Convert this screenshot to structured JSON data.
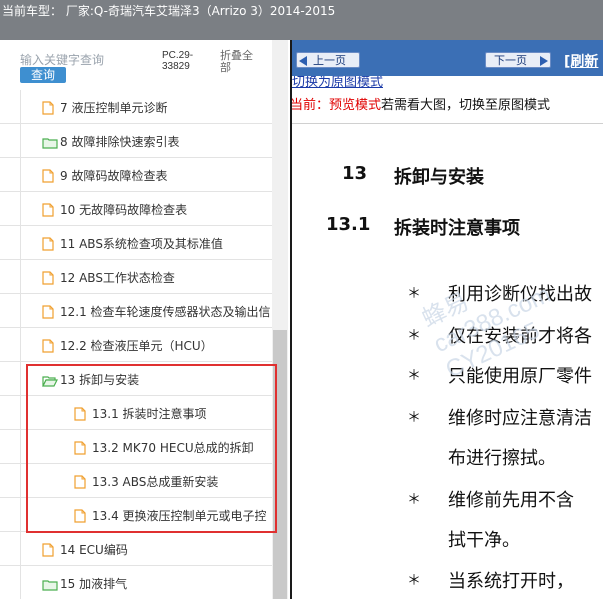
{
  "title_bar": {
    "text": "当前车型：  厂家:Q-奇瑞汽车艾瑞泽3（Arrizo 3）2014-2015"
  },
  "search": {
    "placeholder": "输入关键字查询",
    "button_label": "查询"
  },
  "pc_info": "PC.29-33829",
  "collapse_label": "折叠全部",
  "tree": [
    {
      "label": "7 液压控制单元诊断",
      "level": 1,
      "icon": "file-icon"
    },
    {
      "label": "8 故障排除快速索引表",
      "level": 1,
      "icon": "folder-icon"
    },
    {
      "label": "9 故障码故障检查表",
      "level": 1,
      "icon": "file-icon"
    },
    {
      "label": "10 无故障码故障检查表",
      "level": 1,
      "icon": "file-icon"
    },
    {
      "label": "11 ABS系统检查项及其标准值",
      "level": 1,
      "icon": "file-icon"
    },
    {
      "label": "12 ABS工作状态检查",
      "level": 1,
      "icon": "file-icon"
    },
    {
      "label": "12.1 检查车轮速度传感器状态及输出信",
      "level": 1,
      "icon": "file-icon"
    },
    {
      "label": "12.2 检查液压单元（HCU）",
      "level": 1,
      "icon": "file-icon"
    },
    {
      "label": "13 拆卸与安装",
      "level": 1,
      "icon": "folder-open-icon"
    },
    {
      "label": "13.1 拆装时注意事项",
      "level": 2,
      "icon": "file-icon"
    },
    {
      "label": "13.2 MK70 HECU总成的拆卸",
      "level": 2,
      "icon": "file-icon"
    },
    {
      "label": "13.3 ABS总成重新安装",
      "level": 2,
      "icon": "file-icon"
    },
    {
      "label": "13.4 更换液压控制单元或电子控",
      "level": 2,
      "icon": "file-icon"
    },
    {
      "label": "14 ECU编码",
      "level": 1,
      "icon": "file-icon"
    },
    {
      "label": "15 加液排气",
      "level": 1,
      "icon": "folder-icon"
    }
  ],
  "nav": {
    "prev_label": "上一页",
    "next_label": "下一页",
    "refresh_label": "[刷新"
  },
  "doc_header": {
    "switch_link": "切换为原图模式",
    "mode_label": "当前：预览模式",
    "mode_rest": "若需看大图，切换至原图模式"
  },
  "document": {
    "section_num": "13",
    "section_title": "拆卸与安装",
    "subsection_num": "13.1",
    "subsection_title": "拆装时注意事项",
    "bullet_char": "＊",
    "lines": [
      {
        "text": "利用诊断仪找出故",
        "bullet": true
      },
      {
        "text": "仅在安装前才将各",
        "bullet": true
      },
      {
        "text": "只能使用原厂零件",
        "bullet": true
      },
      {
        "text": "维修时应注意清洁",
        "bullet": true
      },
      {
        "text": "布进行擦拭。",
        "bullet": false
      },
      {
        "text": "维修前先用不含",
        "bullet": true
      },
      {
        "text": "拭干净。",
        "bullet": false
      },
      {
        "text": "当系统打开时，",
        "bullet": true
      }
    ]
  },
  "watermark": {
    "line1": "蜂易",
    "line2": "car388.com",
    "line3": "CY20165"
  },
  "colors": {
    "title_bar": "#7b7f84",
    "nav_bar": "#3b6fb5",
    "highlight": "#e03030",
    "folder": "#4caf50",
    "file": "#f0a030",
    "mode_red": "#e00000",
    "link": "#1a3aa8"
  }
}
